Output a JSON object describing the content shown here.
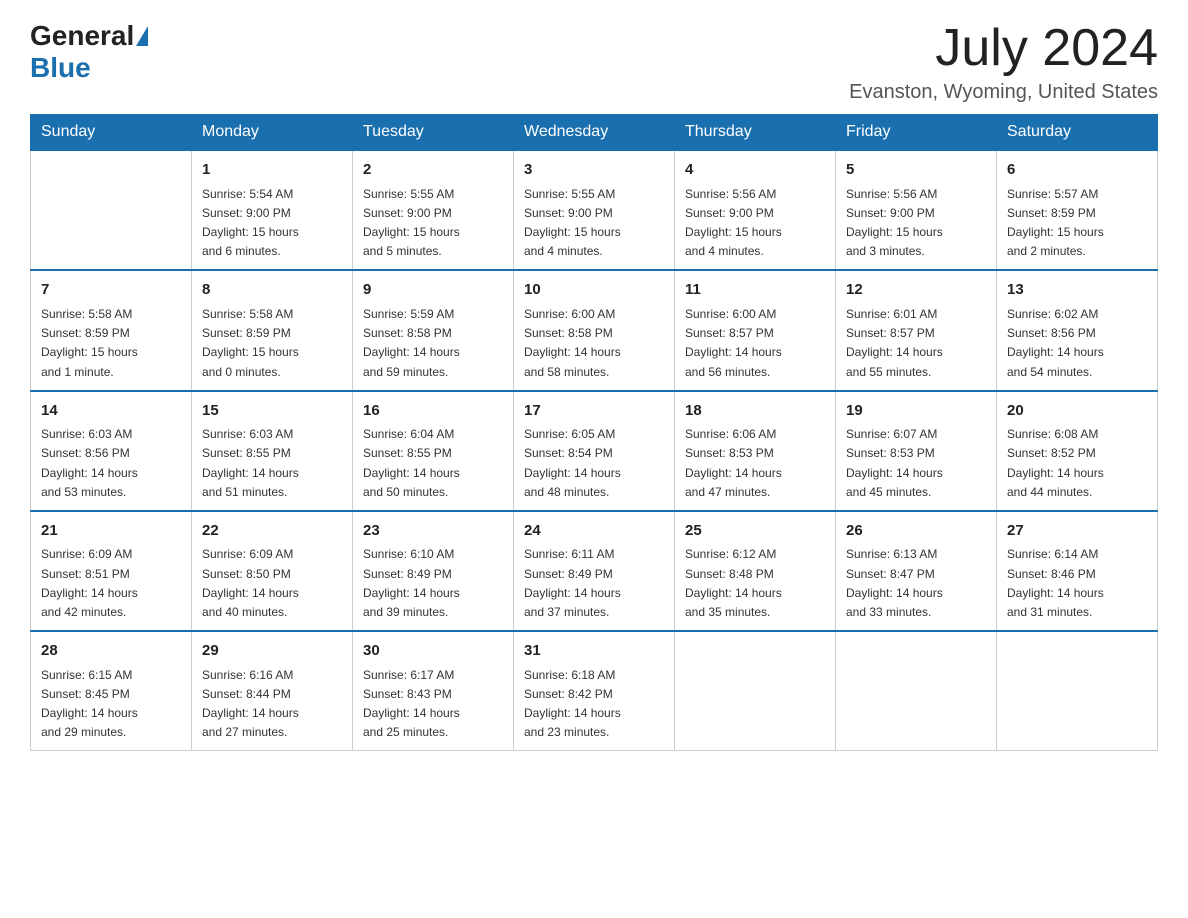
{
  "header": {
    "logo_general": "General",
    "logo_blue": "Blue",
    "title": "July 2024",
    "location": "Evanston, Wyoming, United States"
  },
  "days_of_week": [
    "Sunday",
    "Monday",
    "Tuesday",
    "Wednesday",
    "Thursday",
    "Friday",
    "Saturday"
  ],
  "weeks": [
    [
      {
        "day": "",
        "info": ""
      },
      {
        "day": "1",
        "info": "Sunrise: 5:54 AM\nSunset: 9:00 PM\nDaylight: 15 hours\nand 6 minutes."
      },
      {
        "day": "2",
        "info": "Sunrise: 5:55 AM\nSunset: 9:00 PM\nDaylight: 15 hours\nand 5 minutes."
      },
      {
        "day": "3",
        "info": "Sunrise: 5:55 AM\nSunset: 9:00 PM\nDaylight: 15 hours\nand 4 minutes."
      },
      {
        "day": "4",
        "info": "Sunrise: 5:56 AM\nSunset: 9:00 PM\nDaylight: 15 hours\nand 4 minutes."
      },
      {
        "day": "5",
        "info": "Sunrise: 5:56 AM\nSunset: 9:00 PM\nDaylight: 15 hours\nand 3 minutes."
      },
      {
        "day": "6",
        "info": "Sunrise: 5:57 AM\nSunset: 8:59 PM\nDaylight: 15 hours\nand 2 minutes."
      }
    ],
    [
      {
        "day": "7",
        "info": "Sunrise: 5:58 AM\nSunset: 8:59 PM\nDaylight: 15 hours\nand 1 minute."
      },
      {
        "day": "8",
        "info": "Sunrise: 5:58 AM\nSunset: 8:59 PM\nDaylight: 15 hours\nand 0 minutes."
      },
      {
        "day": "9",
        "info": "Sunrise: 5:59 AM\nSunset: 8:58 PM\nDaylight: 14 hours\nand 59 minutes."
      },
      {
        "day": "10",
        "info": "Sunrise: 6:00 AM\nSunset: 8:58 PM\nDaylight: 14 hours\nand 58 minutes."
      },
      {
        "day": "11",
        "info": "Sunrise: 6:00 AM\nSunset: 8:57 PM\nDaylight: 14 hours\nand 56 minutes."
      },
      {
        "day": "12",
        "info": "Sunrise: 6:01 AM\nSunset: 8:57 PM\nDaylight: 14 hours\nand 55 minutes."
      },
      {
        "day": "13",
        "info": "Sunrise: 6:02 AM\nSunset: 8:56 PM\nDaylight: 14 hours\nand 54 minutes."
      }
    ],
    [
      {
        "day": "14",
        "info": "Sunrise: 6:03 AM\nSunset: 8:56 PM\nDaylight: 14 hours\nand 53 minutes."
      },
      {
        "day": "15",
        "info": "Sunrise: 6:03 AM\nSunset: 8:55 PM\nDaylight: 14 hours\nand 51 minutes."
      },
      {
        "day": "16",
        "info": "Sunrise: 6:04 AM\nSunset: 8:55 PM\nDaylight: 14 hours\nand 50 minutes."
      },
      {
        "day": "17",
        "info": "Sunrise: 6:05 AM\nSunset: 8:54 PM\nDaylight: 14 hours\nand 48 minutes."
      },
      {
        "day": "18",
        "info": "Sunrise: 6:06 AM\nSunset: 8:53 PM\nDaylight: 14 hours\nand 47 minutes."
      },
      {
        "day": "19",
        "info": "Sunrise: 6:07 AM\nSunset: 8:53 PM\nDaylight: 14 hours\nand 45 minutes."
      },
      {
        "day": "20",
        "info": "Sunrise: 6:08 AM\nSunset: 8:52 PM\nDaylight: 14 hours\nand 44 minutes."
      }
    ],
    [
      {
        "day": "21",
        "info": "Sunrise: 6:09 AM\nSunset: 8:51 PM\nDaylight: 14 hours\nand 42 minutes."
      },
      {
        "day": "22",
        "info": "Sunrise: 6:09 AM\nSunset: 8:50 PM\nDaylight: 14 hours\nand 40 minutes."
      },
      {
        "day": "23",
        "info": "Sunrise: 6:10 AM\nSunset: 8:49 PM\nDaylight: 14 hours\nand 39 minutes."
      },
      {
        "day": "24",
        "info": "Sunrise: 6:11 AM\nSunset: 8:49 PM\nDaylight: 14 hours\nand 37 minutes."
      },
      {
        "day": "25",
        "info": "Sunrise: 6:12 AM\nSunset: 8:48 PM\nDaylight: 14 hours\nand 35 minutes."
      },
      {
        "day": "26",
        "info": "Sunrise: 6:13 AM\nSunset: 8:47 PM\nDaylight: 14 hours\nand 33 minutes."
      },
      {
        "day": "27",
        "info": "Sunrise: 6:14 AM\nSunset: 8:46 PM\nDaylight: 14 hours\nand 31 minutes."
      }
    ],
    [
      {
        "day": "28",
        "info": "Sunrise: 6:15 AM\nSunset: 8:45 PM\nDaylight: 14 hours\nand 29 minutes."
      },
      {
        "day": "29",
        "info": "Sunrise: 6:16 AM\nSunset: 8:44 PM\nDaylight: 14 hours\nand 27 minutes."
      },
      {
        "day": "30",
        "info": "Sunrise: 6:17 AM\nSunset: 8:43 PM\nDaylight: 14 hours\nand 25 minutes."
      },
      {
        "day": "31",
        "info": "Sunrise: 6:18 AM\nSunset: 8:42 PM\nDaylight: 14 hours\nand 23 minutes."
      },
      {
        "day": "",
        "info": ""
      },
      {
        "day": "",
        "info": ""
      },
      {
        "day": "",
        "info": ""
      }
    ]
  ]
}
